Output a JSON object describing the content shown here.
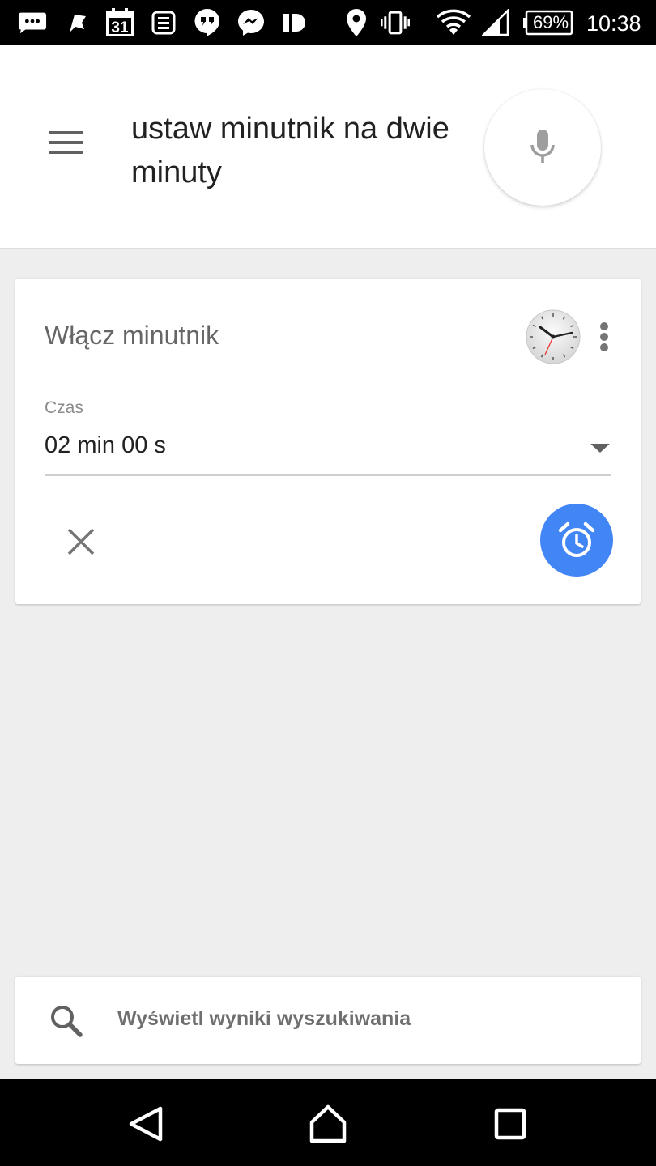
{
  "status_bar": {
    "battery": "69%",
    "time": "10:38",
    "calendar_day": "31",
    "icons": [
      "chat-bubble-icon",
      "flag-icon",
      "calendar-icon",
      "news-icon",
      "hangouts-icon",
      "messenger-icon",
      "id-icon",
      "location-icon",
      "vibrate-icon",
      "wifi-icon",
      "signal-icon",
      "battery-icon"
    ]
  },
  "header": {
    "query_text": "ustaw minutnik na dwie minuty"
  },
  "card": {
    "title": "Włącz minutnik",
    "field_label": "Czas",
    "field_value": "02 min 00 s"
  },
  "search_bar": {
    "label": "Wyświetl wyniki wyszukiwania"
  },
  "colors": {
    "accent": "#4285f4",
    "background": "#eeeeee",
    "card": "#ffffff",
    "status_bar": "#000000"
  }
}
